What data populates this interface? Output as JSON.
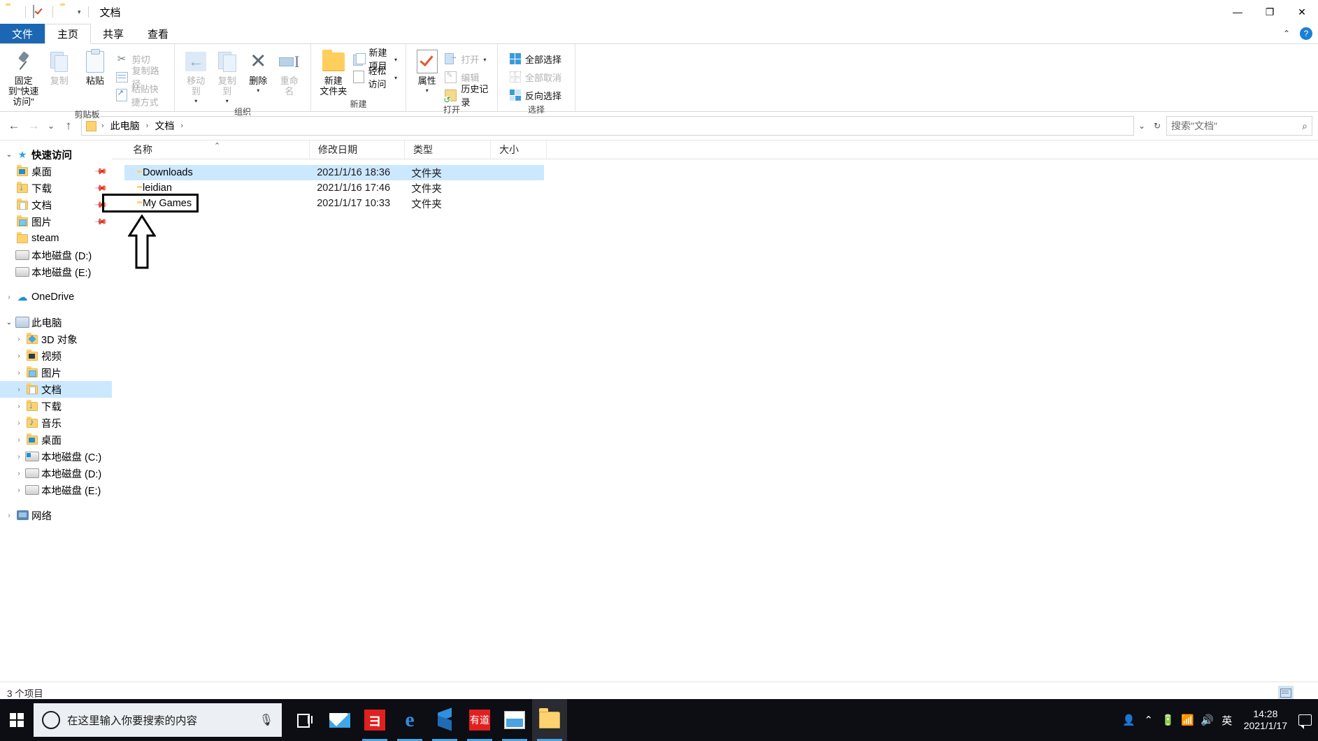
{
  "window": {
    "title": "文档",
    "quick_access_icons": [
      "properties-icon",
      "checkmark-icon",
      "folder-icon",
      "dropdown-caret"
    ],
    "minimize": "—",
    "maximize": "❐",
    "close": "✕"
  },
  "tabs": [
    {
      "label": "文件",
      "id": "file"
    },
    {
      "label": "主页",
      "id": "home"
    },
    {
      "label": "共享",
      "id": "share"
    },
    {
      "label": "查看",
      "id": "view"
    }
  ],
  "ribbon": {
    "groups": [
      {
        "label": "剪贴板",
        "big_buttons": [
          {
            "label": "固定到\"快速访问\"",
            "icon": "pin-icon",
            "disabled": false
          },
          {
            "label": "复制",
            "icon": "copy-icon",
            "disabled": true
          },
          {
            "label": "粘贴",
            "icon": "paste-icon",
            "disabled": false
          }
        ],
        "small_buttons": [
          {
            "label": "剪切",
            "icon": "scissors-icon",
            "disabled": true
          },
          {
            "label": "复制路径",
            "icon": "copy-path-icon",
            "disabled": true
          },
          {
            "label": "粘贴快捷方式",
            "icon": "paste-shortcut-icon",
            "disabled": true
          }
        ]
      },
      {
        "label": "组织",
        "big_buttons": [
          {
            "label": "移动到",
            "icon": "move-to-icon",
            "disabled": true
          },
          {
            "label": "复制到",
            "icon": "copy-to-icon",
            "disabled": true
          },
          {
            "label": "删除",
            "icon": "delete-icon",
            "disabled": false
          },
          {
            "label": "重命名",
            "icon": "rename-icon",
            "disabled": true
          }
        ],
        "small_buttons": []
      },
      {
        "label": "新建",
        "big_buttons": [
          {
            "label": "新建\n文件夹",
            "icon": "new-folder-icon",
            "disabled": false
          }
        ],
        "small_buttons": [
          {
            "label": "新建项目",
            "icon": "new-item-icon",
            "disabled": false
          },
          {
            "label": "轻松访问",
            "icon": "easy-access-icon",
            "disabled": false
          }
        ]
      },
      {
        "label": "打开",
        "big_buttons": [
          {
            "label": "属性",
            "icon": "properties-icon",
            "disabled": false
          }
        ],
        "small_buttons": [
          {
            "label": "打开",
            "icon": "open-icon",
            "disabled": true
          },
          {
            "label": "编辑",
            "icon": "edit-icon",
            "disabled": true
          },
          {
            "label": "历史记录",
            "icon": "history-icon",
            "disabled": false
          }
        ]
      },
      {
        "label": "选择",
        "big_buttons": [],
        "small_buttons": [
          {
            "label": "全部选择",
            "icon": "select-all-icon",
            "disabled": false
          },
          {
            "label": "全部取消",
            "icon": "select-none-icon",
            "disabled": true
          },
          {
            "label": "反向选择",
            "icon": "invert-selection-icon",
            "disabled": false
          }
        ]
      }
    ]
  },
  "address": {
    "back": "←",
    "forward": "→",
    "recent": "⌄",
    "up": "↑",
    "breadcrumbs": [
      "此电脑",
      "文档"
    ],
    "dropdown": "⌄",
    "refresh": "↻"
  },
  "search": {
    "placeholder": "搜索\"文档\"",
    "icon": "search-icon"
  },
  "sidebar": {
    "quick_access": {
      "label": "快速访问",
      "icon": "star-icon",
      "expanded": true,
      "items": [
        {
          "label": "桌面",
          "icon": "desktop-folder-icon",
          "pinned": true
        },
        {
          "label": "下载",
          "icon": "downloads-folder-icon",
          "pinned": true
        },
        {
          "label": "文档",
          "icon": "documents-folder-icon",
          "pinned": true
        },
        {
          "label": "图片",
          "icon": "pictures-folder-icon",
          "pinned": true
        },
        {
          "label": "steam",
          "icon": "folder-icon",
          "pinned": false
        },
        {
          "label": "本地磁盘 (D:)",
          "icon": "drive-icon",
          "pinned": false
        },
        {
          "label": "本地磁盘 (E:)",
          "icon": "drive-icon",
          "pinned": false
        }
      ]
    },
    "onedrive": {
      "label": "OneDrive",
      "icon": "cloud-icon",
      "expanded": false
    },
    "this_pc": {
      "label": "此电脑",
      "icon": "computer-icon",
      "expanded": true,
      "items": [
        {
          "label": "3D 对象",
          "icon": "3d-objects-icon",
          "selected": false
        },
        {
          "label": "视频",
          "icon": "videos-folder-icon",
          "selected": false
        },
        {
          "label": "图片",
          "icon": "pictures-folder-icon",
          "selected": false
        },
        {
          "label": "文档",
          "icon": "documents-folder-icon",
          "selected": true
        },
        {
          "label": "下载",
          "icon": "downloads-folder-icon",
          "selected": false
        },
        {
          "label": "音乐",
          "icon": "music-folder-icon",
          "selected": false
        },
        {
          "label": "桌面",
          "icon": "desktop-folder-icon",
          "selected": false
        },
        {
          "label": "本地磁盘 (C:)",
          "icon": "system-drive-icon",
          "selected": false
        },
        {
          "label": "本地磁盘 (D:)",
          "icon": "drive-icon",
          "selected": false
        },
        {
          "label": "本地磁盘 (E:)",
          "icon": "drive-icon",
          "selected": false
        }
      ]
    },
    "network": {
      "label": "网络",
      "icon": "network-icon",
      "expanded": false
    }
  },
  "filelist": {
    "columns": [
      {
        "label": "名称",
        "sorted": true
      },
      {
        "label": "修改日期",
        "sorted": false
      },
      {
        "label": "类型",
        "sorted": false
      },
      {
        "label": "大小",
        "sorted": false
      }
    ],
    "rows": [
      {
        "name": "Downloads",
        "date": "2021/1/16 18:36",
        "type": "文件夹",
        "size": "",
        "selected": true,
        "annotated": false
      },
      {
        "name": "leidian",
        "date": "2021/1/16 17:46",
        "type": "文件夹",
        "size": "",
        "selected": false,
        "annotated": false
      },
      {
        "name": "My Games",
        "date": "2021/1/17 10:33",
        "type": "文件夹",
        "size": "",
        "selected": false,
        "annotated": true
      }
    ]
  },
  "status": {
    "count": "3 个项目",
    "views": [
      "details-view-icon",
      "thumbnail-view-icon"
    ]
  },
  "taskbar": {
    "start": "windows-logo-icon",
    "search_placeholder": "在这里输入你要搜索的内容",
    "mic_icon": "microphone-icon",
    "cortana_icon": "cortana-circle-icon",
    "taskview_icon": "task-view-icon",
    "apps": [
      {
        "name": "mail-app-icon",
        "running": false
      },
      {
        "name": "wps-app-icon",
        "running": true
      },
      {
        "name": "edge-browser-icon",
        "running": true
      },
      {
        "name": "cube-app-icon",
        "running": true
      },
      {
        "name": "youdao-app-icon",
        "label": "有道",
        "running": true
      },
      {
        "name": "photos-app-icon",
        "running": true
      },
      {
        "name": "file-explorer-icon",
        "running": true,
        "active": true
      }
    ],
    "tray": {
      "people_icon": "people-icon",
      "chevron": "⌃",
      "battery_icon": "battery-icon",
      "network_icon": "wifi-icon",
      "volume_icon": "speaker-icon",
      "ime": "英",
      "time": "14:28",
      "date": "2021/1/17",
      "notification_icon": "notification-icon"
    }
  }
}
